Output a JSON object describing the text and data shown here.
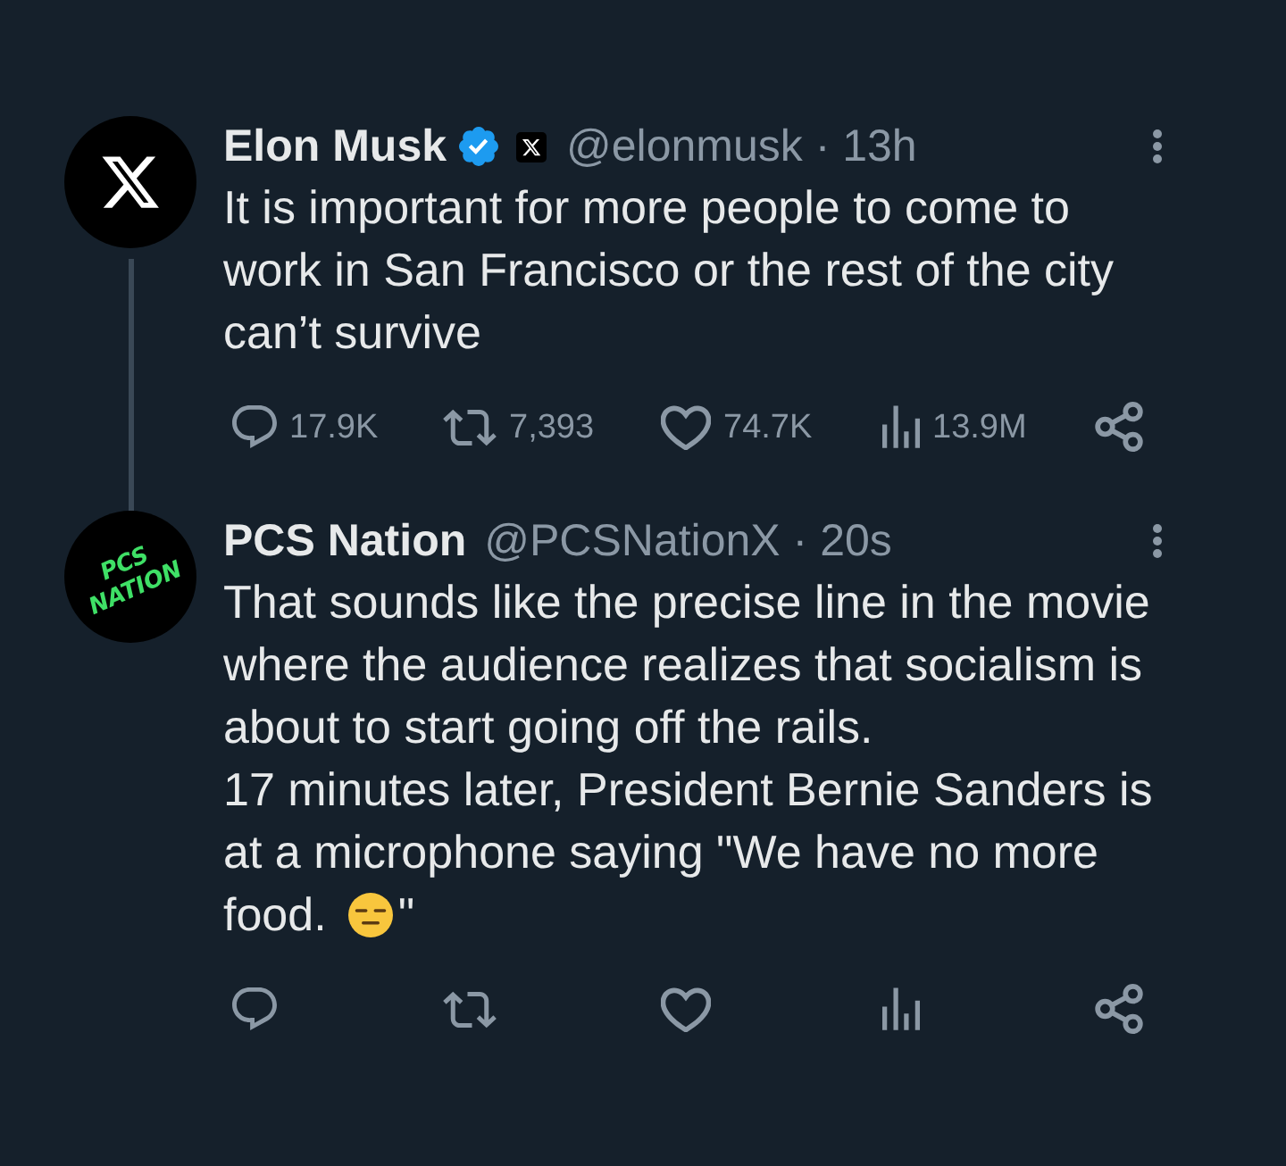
{
  "tweets": [
    {
      "avatar": {
        "kind": "x-logo"
      },
      "name": "Elon Musk",
      "verified": true,
      "affiliate_badge": true,
      "meta": "@elonmusk · 13h",
      "thread_line": true,
      "paragraphs": [
        [
          {
            "kind": "text",
            "text": "It is important for more people to come to work in San Francisco or the rest of the city can’t survive"
          }
        ]
      ],
      "actions": [
        {
          "kind": "reply",
          "count": "17.9K"
        },
        {
          "kind": "repost",
          "count": "7,393"
        },
        {
          "kind": "like",
          "count": "74.7K"
        },
        {
          "kind": "views",
          "count": "13.9M"
        },
        {
          "kind": "share"
        }
      ]
    },
    {
      "avatar": {
        "kind": "text-logo",
        "text": "PCS NATION"
      },
      "name": "PCS Nation",
      "verified": false,
      "affiliate_badge": false,
      "meta": "@PCSNationX · 20s",
      "thread_line": false,
      "paragraphs": [
        [
          {
            "kind": "text",
            "text": "That sounds like the precise line in the movie where the audience realizes that socialism is about to start going off the rails."
          }
        ],
        [
          {
            "kind": "text",
            "text": "17 minutes later, President Bernie Sanders is at a microphone saying \"We have no more food."
          },
          {
            "kind": "emoji"
          },
          {
            "kind": "text",
            "text": "\""
          }
        ]
      ],
      "actions": [
        {
          "kind": "reply"
        },
        {
          "kind": "repost"
        },
        {
          "kind": "like"
        },
        {
          "kind": "views"
        },
        {
          "kind": "share"
        }
      ]
    }
  ]
}
